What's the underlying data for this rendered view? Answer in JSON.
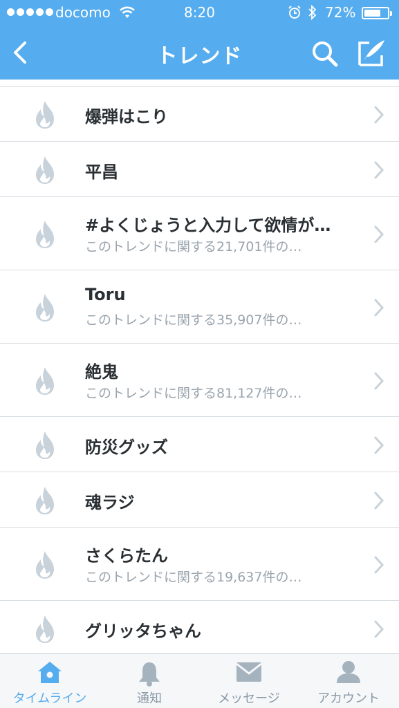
{
  "status_bar": {
    "carrier": "docomo",
    "time": "8:20",
    "battery": "72%",
    "battery_level": 0.72
  },
  "nav": {
    "title": "トレンド",
    "back_icon": "chevron-left-icon",
    "search_icon": "search-icon",
    "compose_icon": "compose-icon"
  },
  "colors": {
    "header": "#55acee",
    "title_text": "#292f33",
    "sub_text": "#9aa4ad",
    "icon_gray": "#c8d2da",
    "tab_active": "#55acee",
    "tab_inactive": "#8899a6"
  },
  "trends": [
    {
      "title": "爆弾はこり",
      "subtitle": ""
    },
    {
      "title": "平昌",
      "subtitle": ""
    },
    {
      "title": "#よくじょうと入力して欲情が…",
      "subtitle": "このトレンドに関する21,701件の…"
    },
    {
      "title": "Toru",
      "subtitle": "このトレンドに関する35,907件の…"
    },
    {
      "title": "絶鬼",
      "subtitle": "このトレンドに関する81,127件の…"
    },
    {
      "title": "防災グッズ",
      "subtitle": ""
    },
    {
      "title": "魂ラジ",
      "subtitle": ""
    },
    {
      "title": "さくらたん",
      "subtitle": "このトレンドに関する19,637件の…"
    },
    {
      "title": "グリッタちゃん",
      "subtitle": ""
    }
  ],
  "tabs": [
    {
      "label": "タイムライン",
      "icon": "home-icon",
      "active": true
    },
    {
      "label": "通知",
      "icon": "bell-icon",
      "active": false
    },
    {
      "label": "メッセージ",
      "icon": "envelope-icon",
      "active": false
    },
    {
      "label": "アカウント",
      "icon": "person-icon",
      "active": false
    }
  ]
}
